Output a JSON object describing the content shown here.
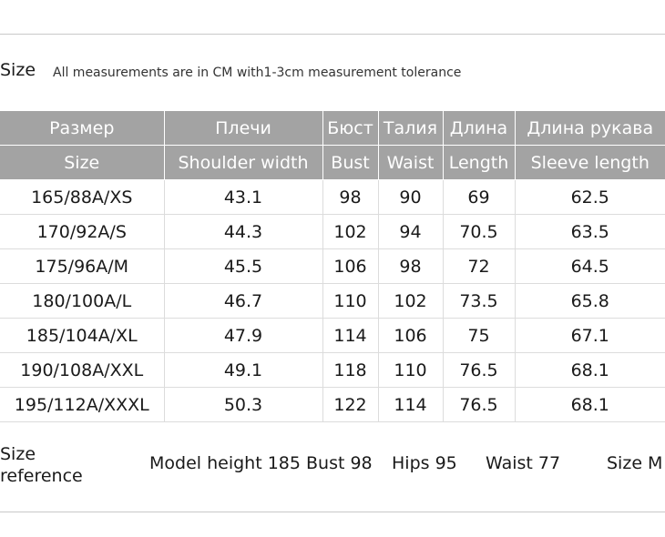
{
  "header": {
    "size_label": "Size",
    "note": "All measurements are in CM with1-3cm measurement tolerance"
  },
  "table": {
    "header_ru": [
      "Размер",
      "Плечи",
      "Бюст",
      "Талия",
      "Длина",
      "Длина рукава"
    ],
    "header_en": [
      "Size",
      "Shoulder width",
      "Bust",
      "Waist",
      "Length",
      "Sleeve length"
    ],
    "rows": [
      [
        "165/88A/XS",
        "43.1",
        "98",
        "90",
        "69",
        "62.5"
      ],
      [
        "170/92A/S",
        "44.3",
        "102",
        "94",
        "70.5",
        "63.5"
      ],
      [
        "175/96A/M",
        "45.5",
        "106",
        "98",
        "72",
        "64.5"
      ],
      [
        "180/100A/L",
        "46.7",
        "110",
        "102",
        "73.5",
        "65.8"
      ],
      [
        "185/104A/XL",
        "47.9",
        "114",
        "106",
        "75",
        "67.1"
      ],
      [
        "190/108A/XXL",
        "49.1",
        "118",
        "110",
        "76.5",
        "68.1"
      ],
      [
        "195/112A/XXXL",
        "50.3",
        "122",
        "114",
        "76.5",
        "68.1"
      ]
    ]
  },
  "reference": {
    "label_line1": "Size",
    "label_line2": "reference",
    "model": "Model height 185 Bust 98",
    "hips": "Hips 95",
    "waist": "Waist 77",
    "size": "Size M"
  }
}
